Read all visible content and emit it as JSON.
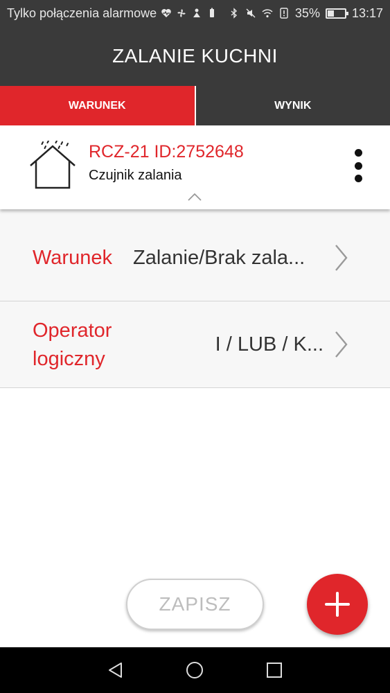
{
  "status_bar": {
    "carrier_text": "Tylko połączenia alarmowe",
    "battery_percent": "35%",
    "battery_level": 0.35,
    "time": "13:17",
    "icons": [
      "heart-rate-icon",
      "fan-icon",
      "recycle-icon",
      "battery-saver-icon",
      "bluetooth-icon",
      "mute-icon",
      "wifi-icon",
      "sim-alert-icon",
      "battery-icon"
    ]
  },
  "header": {
    "title": "ZALANIE KUCHNI"
  },
  "tabs": [
    {
      "label": "WARUNEK",
      "active": true
    },
    {
      "label": "WYNIK",
      "active": false
    }
  ],
  "device": {
    "name": "RCZ-21 ID:2752648",
    "type": "Czujnik zalania",
    "icon": "house-water-sensor-icon"
  },
  "settings": {
    "condition": {
      "label": "Warunek",
      "value": "Zalanie/Brak zala..."
    },
    "operator": {
      "label_line1": "Operator",
      "label_line2": "logiczny",
      "value": "I / LUB / K..."
    }
  },
  "actions": {
    "save_label": "ZAPISZ",
    "add_icon": "plus-icon"
  },
  "navigation": {
    "buttons": [
      "back-icon",
      "home-icon",
      "recent-apps-icon"
    ]
  },
  "colors": {
    "accent": "#e0262b",
    "header_bg": "#3a3a3a",
    "row_bg": "#f7f7f7"
  }
}
